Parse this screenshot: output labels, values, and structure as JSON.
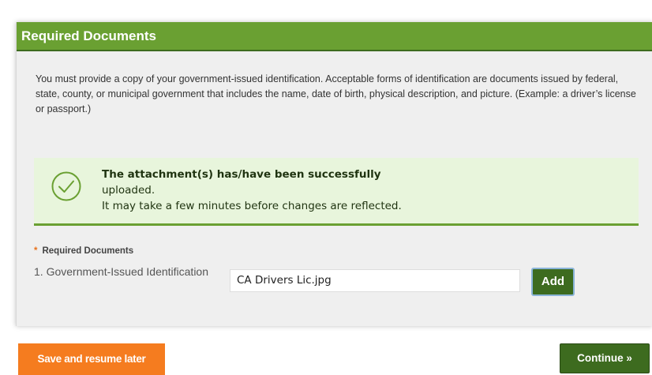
{
  "section": {
    "title": "Required Documents",
    "description": "You must provide a copy of your government-issued identification.  Acceptable forms of identification are documents issued by federal, state, county, or municipal government that includes the name, date of birth, physical description, and picture. (Example: a driver’s license or passport.)"
  },
  "notice": {
    "icon": "check-circle-icon",
    "title": "The attachment(s) has/have been successfully",
    "line1": "uploaded.",
    "line2": "It may take a few minutes before changes are reflected."
  },
  "documents": {
    "required_marker": "*",
    "required_label": "Required Documents",
    "item_label": "1. Government-Issued Identification",
    "file_value": "CA Drivers Lic.jpg",
    "add_label": "Add"
  },
  "footer": {
    "save_label": "Save and resume later",
    "continue_label": "Continue »"
  },
  "colors": {
    "header_green": "#6aa032",
    "button_green": "#3d6b1f",
    "save_orange": "#f57c1f",
    "notice_bg": "#e8f5dc"
  }
}
